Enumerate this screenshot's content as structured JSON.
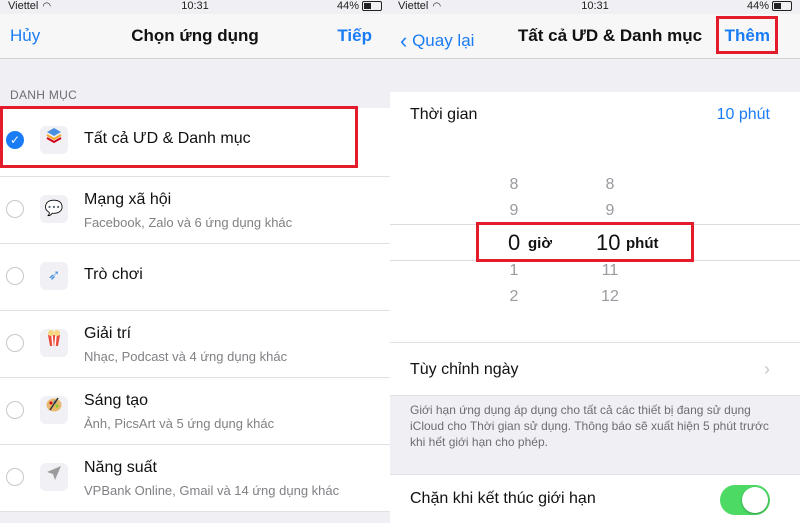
{
  "left": {
    "status": {
      "carrier": "Viettel",
      "time": "10:31",
      "battery": "44%"
    },
    "nav": {
      "left": "Hủy",
      "title": "Chọn ứng dụng",
      "right": "Tiếp"
    },
    "section_header": "DANH MỤC",
    "categories": [
      {
        "title": "Tất cả ƯD & Danh mục",
        "subtitle": "",
        "icon": "layers-icon",
        "checked": true
      },
      {
        "title": "Mạng xã hội",
        "subtitle": "Facebook, Zalo và 6 ứng dụng khác",
        "icon": "chat-heart-icon",
        "checked": false
      },
      {
        "title": "Trò chơi",
        "subtitle": "",
        "icon": "rocket-icon",
        "checked": false
      },
      {
        "title": "Giải trí",
        "subtitle": "Nhạc, Podcast và 4 ứng dụng khác",
        "icon": "popcorn-icon",
        "checked": false
      },
      {
        "title": "Sáng tạo",
        "subtitle": "Ảnh, PicsArt và 5 ứng dụng khác",
        "icon": "palette-icon",
        "checked": false
      },
      {
        "title": "Năng suất",
        "subtitle": "VPBank Online, Gmail và 14 ứng dụng khác",
        "icon": "paper-plane-icon",
        "checked": false
      }
    ]
  },
  "right": {
    "status": {
      "carrier": "Viettel",
      "time": "10:31",
      "battery": "44%"
    },
    "nav": {
      "back": "Quay lại",
      "title": "Tất cả ƯD & Danh mục",
      "right": "Thêm"
    },
    "time_label": "Thời gian",
    "time_value": "10 phút",
    "picker": {
      "hours_above": [
        "8",
        "9"
      ],
      "hours_selected": "0",
      "hours_unit": "giờ",
      "hours_below": [
        "1",
        "2"
      ],
      "minutes_above": [
        "8",
        "9"
      ],
      "minutes_selected": "10",
      "minutes_unit": "phút",
      "minutes_below": [
        "11",
        "12"
      ]
    },
    "custom_days": "Tùy chỉnh ngày",
    "note": "Giới hạn ứng dụng áp dụng cho tất cả các thiết bị đang sử dụng iCloud cho Thời gian sử dụng. Thông báo sẽ xuất hiện 5 phút trước khi hết giới hạn cho phép.",
    "block_label": "Chặn khi kết thúc giới hạn",
    "block_enabled": true
  },
  "colors": {
    "accent": "#1a7cf5",
    "highlight": "#e21c2a",
    "toggle_on": "#4cd964"
  }
}
